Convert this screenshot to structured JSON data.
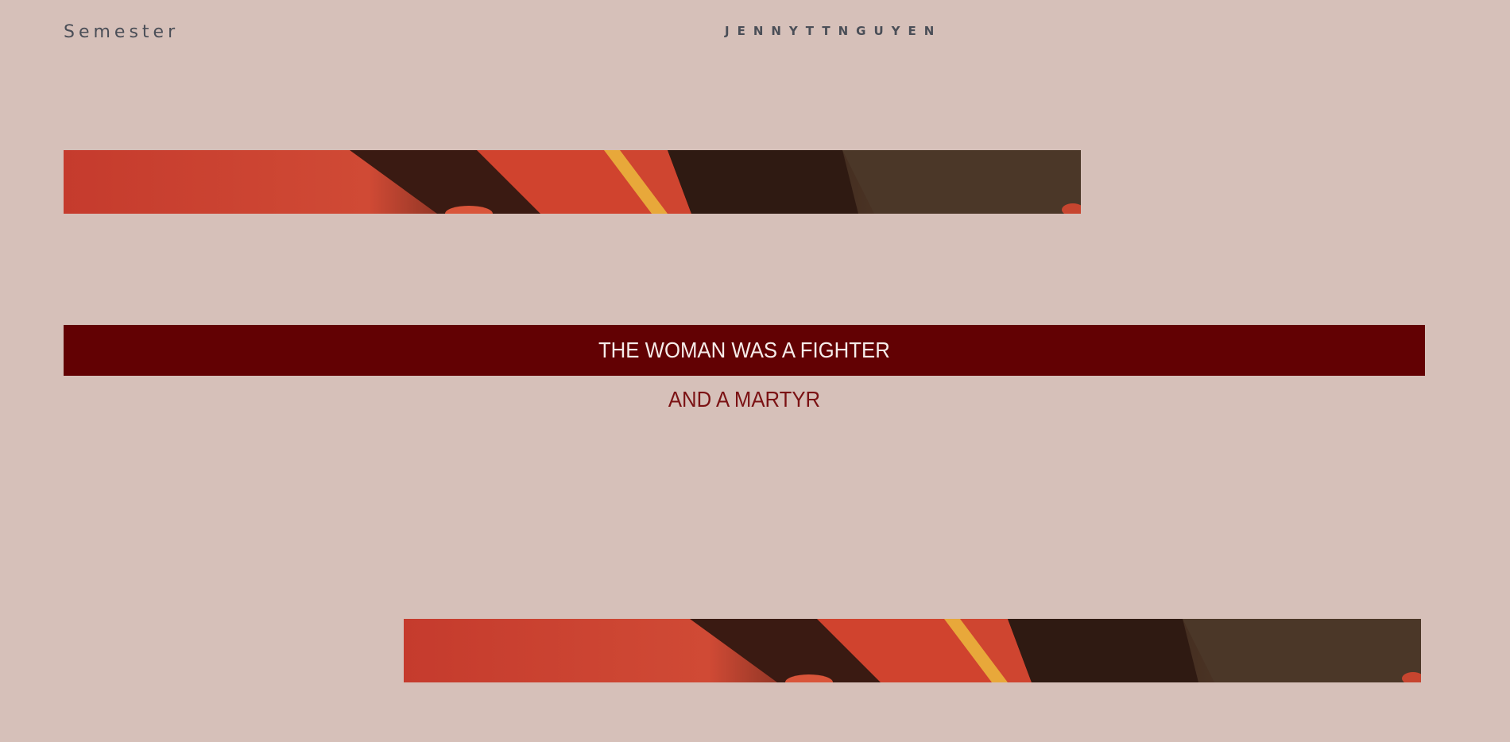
{
  "nav": {
    "left_label": "Semester",
    "brand": "JENNYTTNGUYEN"
  },
  "hero": {
    "title": "THE WOMAN WAS A FIGHTER",
    "subtitle": "AND A MARTYR"
  },
  "colors": {
    "background": "#d6c0b9",
    "title_bar": "#620103",
    "title_text": "#f6ecea",
    "subtitle_text": "#7b1214",
    "nav_text": "#4a4e57"
  }
}
